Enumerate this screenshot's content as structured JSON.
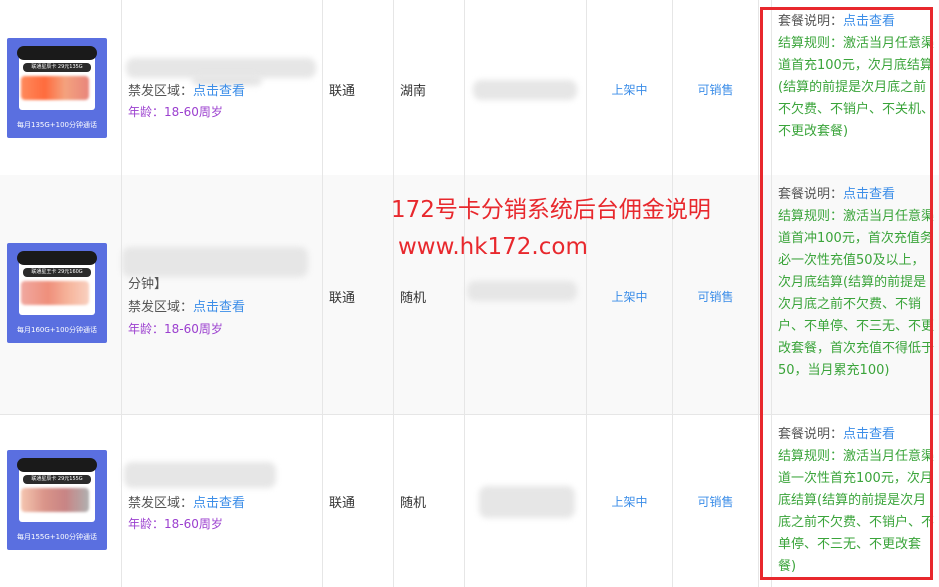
{
  "overlay": {
    "title": "172号卡分销系统后台佣金说明",
    "url": "www.hk172.com"
  },
  "rows": [
    {
      "thumb_caption": "每月135G+100分钟通话",
      "thumb_title": "联通星辰卡 29元135G",
      "name_extra": "",
      "region_label": "禁发区域：",
      "region_link": "点击查看",
      "age": "年龄：18-60周岁",
      "operator": "联通",
      "province": "湖南",
      "shelf_status": "上架中",
      "sale_status": "可销售",
      "desc_label": "套餐说明：",
      "desc_link": "点击查看",
      "rule_label": "结算规则：",
      "rule_text": "激活当月任意渠道首充100元，次月底结算(结算的前提是次月底之前不欠费、不销户、不关机、不更改套餐)"
    },
    {
      "thumb_caption": "每月160G+100分钟通话",
      "thumb_title": "联通星王卡 29元160G",
      "name_extra": "分钟】",
      "region_label": "禁发区域：",
      "region_link": "点击查看",
      "age": "年龄：18-60周岁",
      "operator": "联通",
      "province": "随机",
      "shelf_status": "上架中",
      "sale_status": "可销售",
      "desc_label": "套餐说明：",
      "desc_link": "点击查看",
      "rule_label": "结算规则：",
      "rule_text": "激活当月任意渠道首冲100元，首次充值务必一次性充值50及以上，次月底结算(结算的前提是次月底之前不欠费、不销户、不单停、不三无、不更改套餐，首次充值不得低于50，当月累充100)"
    },
    {
      "thumb_caption": "每月155G+100分钟通话",
      "thumb_title": "联通星辰卡 29元155G",
      "name_extra": "",
      "region_label": "禁发区域：",
      "region_link": "点击查看",
      "age": "年龄：18-60周岁",
      "operator": "联通",
      "province": "随机",
      "shelf_status": "上架中",
      "sale_status": "可销售",
      "desc_label": "套餐说明：",
      "desc_link": "点击查看",
      "rule_label": "结算规则：",
      "rule_text": "激活当月任意渠道一次性首充100元，次月底结算(结算的前提是次月底之前不欠费、不销户、不单停、不三无、不更改套餐)"
    }
  ],
  "colors": {
    "link": "#3b8de8",
    "rule": "#3aa43a",
    "age": "#9b3fcf",
    "highlight": "#e8282d",
    "thumb_bg": "#5a6fe0"
  }
}
